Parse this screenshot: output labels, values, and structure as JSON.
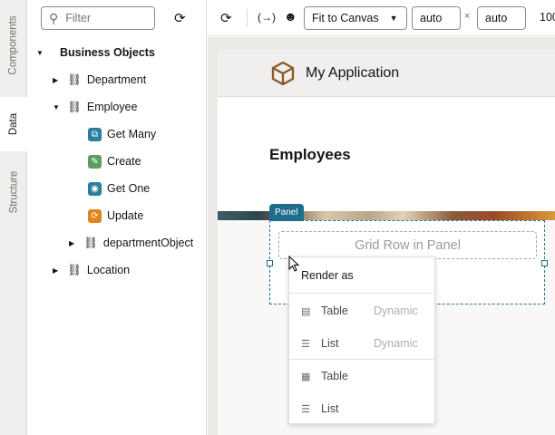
{
  "rail": {
    "tabs": [
      {
        "label": "Components"
      },
      {
        "label": "Data",
        "active": true
      },
      {
        "label": "Structure"
      }
    ]
  },
  "left": {
    "filter_placeholder": "Filter",
    "tree": [
      {
        "label": "Business Objects",
        "expanded": true
      },
      {
        "label": "Department",
        "icon": "database-icon"
      },
      {
        "label": "Employee",
        "icon": "database-icon",
        "expanded": true
      },
      {
        "label": "Get Many",
        "icon": "get-many-icon",
        "color": "#2a7f9c"
      },
      {
        "label": "Create",
        "icon": "pencil-icon",
        "color": "#5d9e5f"
      },
      {
        "label": "Get One",
        "icon": "eye-icon",
        "color": "#2a7f9c"
      },
      {
        "label": "Update",
        "icon": "refresh-icon",
        "color": "#e0851b"
      },
      {
        "label": "departmentObject",
        "icon": "database-icon"
      },
      {
        "label": "Location",
        "icon": "database-icon"
      }
    ]
  },
  "toolbar": {
    "fit_label": "Fit to Canvas",
    "width": "auto",
    "times": "×",
    "height": "auto",
    "zoom": "100"
  },
  "app": {
    "title": "My Application",
    "heading": "Employees",
    "panel_label": "Panel",
    "grid_row_label": "Grid Row in Panel"
  },
  "menu": {
    "header": "Render as",
    "items": [
      {
        "label": "Table",
        "sub": "Dynamic",
        "icon": "dynamic-table-icon"
      },
      {
        "label": "List",
        "sub": "Dynamic",
        "icon": "list-icon"
      },
      {
        "label": "Table",
        "icon": "table-icon"
      },
      {
        "label": "List",
        "icon": "list-icon"
      }
    ]
  }
}
